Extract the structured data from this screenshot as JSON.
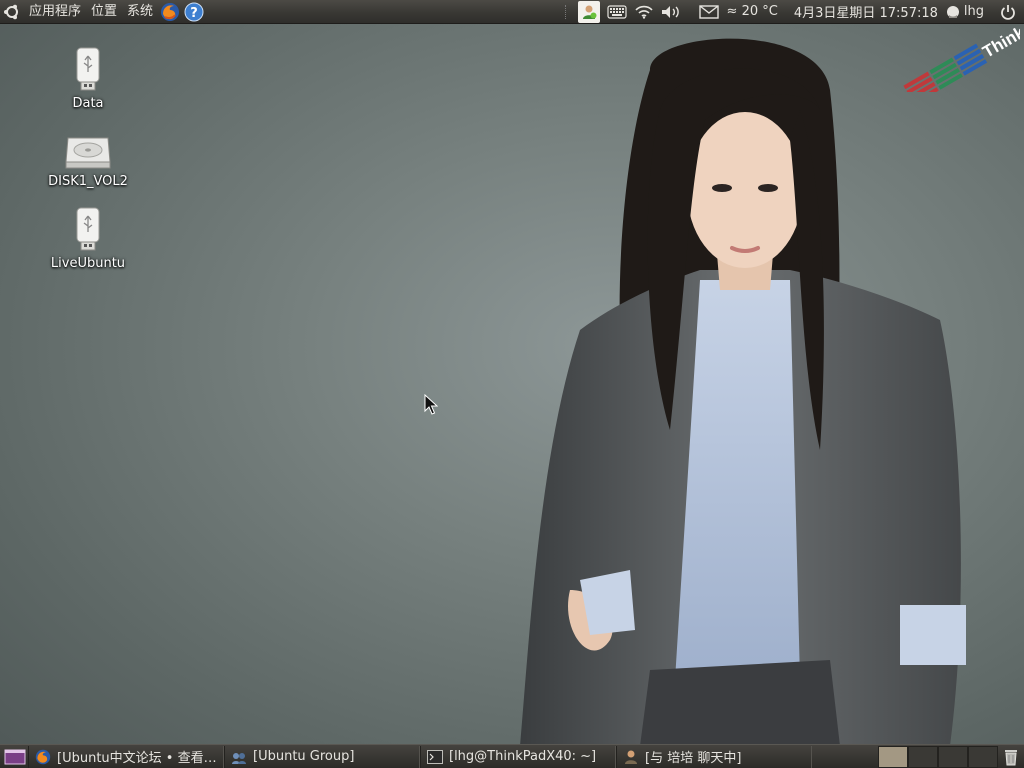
{
  "top_panel": {
    "menus": [
      "应用程序",
      "位置",
      "系统"
    ],
    "launchers": [
      "firefox-icon",
      "help-icon"
    ],
    "tray": {
      "weather": "≈ 20 °C",
      "datetime": "4月3日星期日 17:57:18",
      "user": "lhg"
    }
  },
  "desktop": {
    "icons": [
      {
        "label": "Data",
        "icon": "usb-drive-icon"
      },
      {
        "label": "DISK1_VOL2",
        "icon": "hard-disk-icon"
      },
      {
        "label": "LiveUbuntu",
        "icon": "usb-drive-icon"
      }
    ]
  },
  "taskbar": {
    "tasks": [
      {
        "label": "[Ubuntu中文论坛 • 查看…",
        "icon": "firefox-icon"
      },
      {
        "label": "[Ubuntu Group]",
        "icon": "chat-icon"
      },
      {
        "label": "[lhg@ThinkPadX40: ~]",
        "icon": "terminal-icon"
      },
      {
        "label": "[与 培培 聊天中]",
        "icon": "im-chat-icon"
      }
    ],
    "workspaces": 4,
    "active_workspace": 1
  },
  "colors": {
    "panel": "#3a3935",
    "desktop": "#6f7977",
    "active_workspace": "#a39883"
  }
}
